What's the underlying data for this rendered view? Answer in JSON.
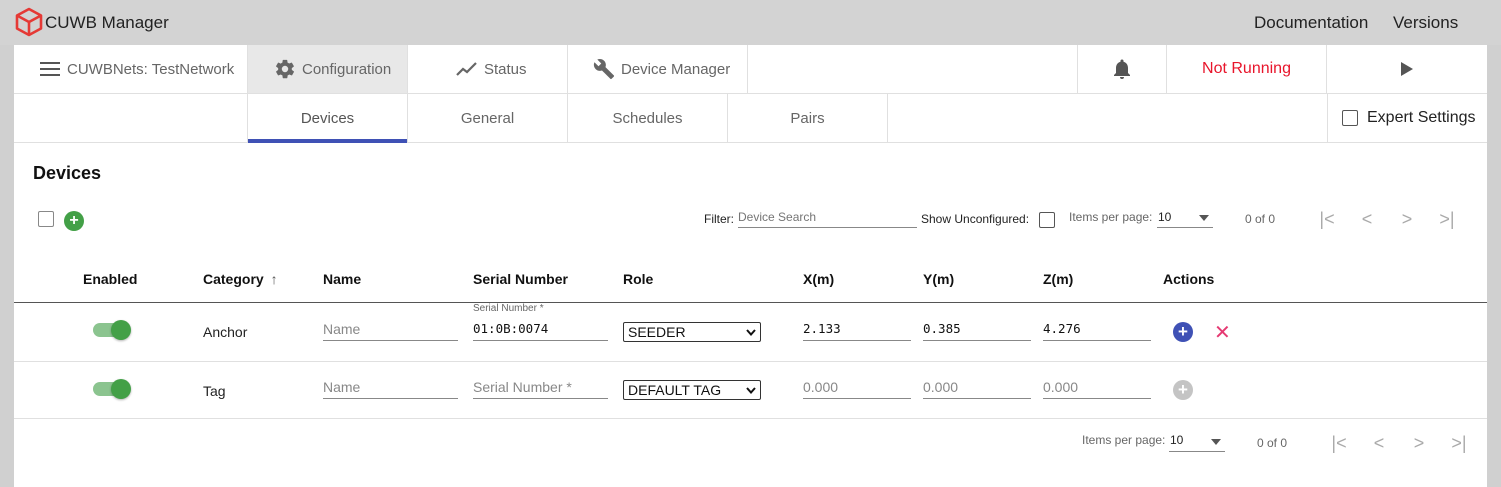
{
  "app": {
    "title": "CUWB Manager",
    "logo": "cuwb-cube-logo",
    "brand_color": "#e53935"
  },
  "top_links": [
    "Documentation",
    "Versions"
  ],
  "navbar": {
    "network": {
      "icon": "menu-icon",
      "label": "CUWBNets: TestNetwork"
    },
    "configuration": {
      "icon": "gear-icon",
      "label": "Configuration"
    },
    "status": {
      "icon": "trend-line-icon",
      "label": "Status"
    },
    "device_manager": {
      "icon": "wrench-icon",
      "label": "Device Manager"
    },
    "notifications_icon": "bell-icon",
    "run_state": {
      "label": "Not Running",
      "color": "#e8152b"
    },
    "play_icon": "play-icon"
  },
  "subtabs": [
    "Devices",
    "General",
    "Schedules",
    "Pairs"
  ],
  "active_subtab": "Devices",
  "accent_color": "#3f51b5",
  "expert_settings": {
    "label": "Expert Settings",
    "checked": false
  },
  "devices": {
    "title": "Devices",
    "filter": {
      "label": "Filter:",
      "placeholder": "Device Search"
    },
    "show_unconfigured": {
      "label": "Show Unconfigured:",
      "checked": false
    },
    "pager_top": {
      "label": "Items per page:",
      "value": "10",
      "range": "0 of 0"
    },
    "pager_bottom": {
      "label": "Items per page:",
      "value": "10",
      "range": "0 of 0"
    },
    "columns": [
      "Enabled",
      "Category",
      "Name",
      "Serial Number",
      "Role",
      "X(m)",
      "Y(m)",
      "Z(m)",
      "Actions"
    ],
    "sort_icon": "arrow-up-icon",
    "rows": [
      {
        "enabled": true,
        "category": "Anchor",
        "name_placeholder": "Name",
        "serial_label": "Serial Number *",
        "serial": "01:0B:0074",
        "role": "SEEDER",
        "x": "2.133",
        "y": "0.385",
        "z": "4.276"
      },
      {
        "enabled": true,
        "category": "Tag",
        "name_placeholder": "Name",
        "serial_placeholder": "Serial Number *",
        "role": "DEFAULT TAG",
        "x": "0.000",
        "y": "0.000",
        "z": "0.000"
      }
    ]
  }
}
